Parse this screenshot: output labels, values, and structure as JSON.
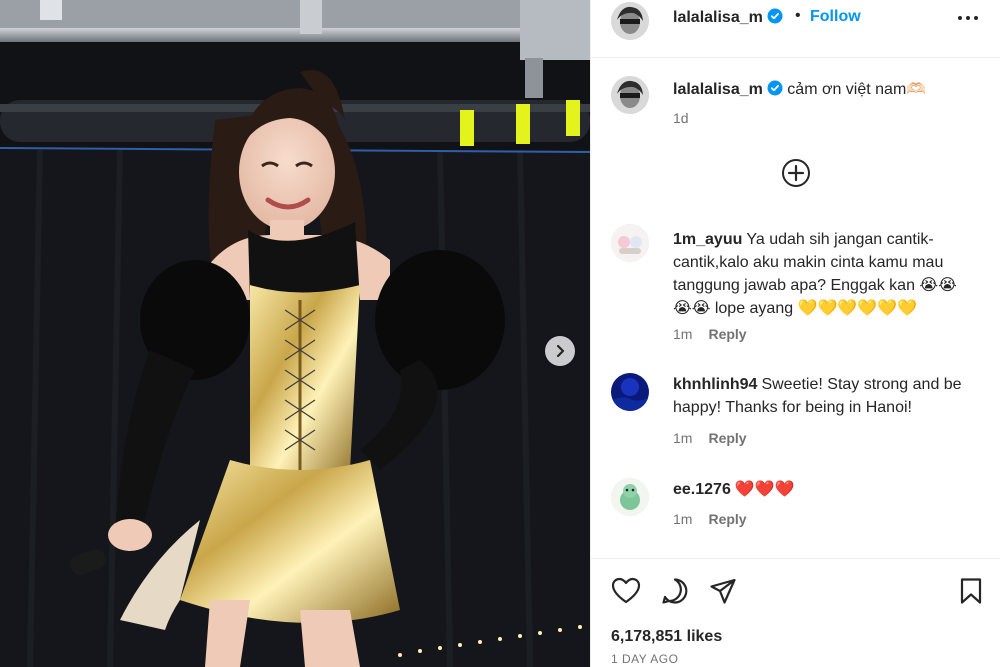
{
  "post": {
    "author": "lalalalisa_m",
    "follow_label": "Follow",
    "separator": "•",
    "caption": "cảm ơn việt nam🫶🏻",
    "caption_time": "1d",
    "likes": "6,178,851 likes",
    "date": "1 DAY AGO"
  },
  "comments": [
    {
      "user": "1m_ayuu",
      "text": "Ya udah sih jangan cantik-cantik,kalo aku makin cinta kamu mau tanggung jawab apa? Enggak kan 😭😭😭😭 lope ayang 💛💛💛💛💛💛",
      "time": "1m",
      "reply_label": "Reply"
    },
    {
      "user": "khnhlinh94",
      "text": "Sweetie! Stay strong and be happy! Thanks for being in Hanoi!",
      "time": "1m",
      "reply_label": "Reply"
    },
    {
      "user": "ee.1276",
      "text": "❤️❤️❤️",
      "time": "1m",
      "reply_label": "Reply"
    }
  ],
  "icons": {
    "verified": "verified-badge-icon",
    "more": "more-options-icon",
    "load_more": "plus-circle-icon",
    "like": "heart-icon",
    "comment": "comment-bubble-icon",
    "share": "paper-plane-icon",
    "save": "bookmark-icon",
    "next": "chevron-right-icon"
  },
  "colors": {
    "accent": "#0095f6",
    "text": "#262626",
    "muted": "#737373",
    "verified": "#0095f6"
  }
}
